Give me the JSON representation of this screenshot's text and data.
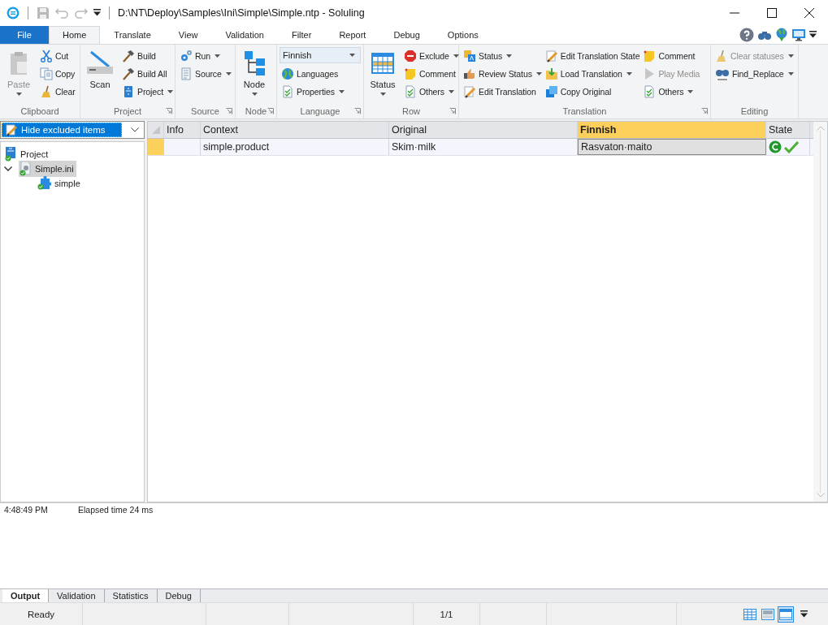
{
  "window": {
    "title": "D:\\NT\\Deploy\\Samples\\Ini\\Simple\\Simple.ntp  -  Soluling"
  },
  "ribbon": {
    "tabs": [
      {
        "label": "File",
        "kind": "file",
        "selected": false
      },
      {
        "label": "Home",
        "kind": "tab",
        "selected": true
      },
      {
        "label": "Translate",
        "kind": "tab",
        "selected": false
      },
      {
        "label": "View",
        "kind": "tab",
        "selected": false
      },
      {
        "label": "Validation",
        "kind": "tab",
        "selected": false
      },
      {
        "label": "Filter",
        "kind": "tab",
        "selected": false
      },
      {
        "label": "Report",
        "kind": "tab",
        "selected": false
      },
      {
        "label": "Debug",
        "kind": "tab",
        "selected": false
      },
      {
        "label": "Options",
        "kind": "tab",
        "selected": false
      }
    ],
    "groups": [
      {
        "label": "Clipboard",
        "launcher": false,
        "columns": [
          [
            {
              "kind": "large",
              "label": "Paste",
              "dropdown": true,
              "disabled": true
            }
          ],
          [
            {
              "kind": "small",
              "label": "Cut",
              "dropdown": false,
              "disabled": false
            },
            {
              "kind": "small",
              "label": "Copy",
              "dropdown": false,
              "disabled": false
            },
            {
              "kind": "small",
              "label": "Clear",
              "dropdown": false,
              "disabled": false
            }
          ]
        ]
      },
      {
        "label": "Project",
        "launcher": true,
        "columns": [
          [
            {
              "kind": "large",
              "label": "Scan",
              "dropdown": false,
              "disabled": false
            }
          ],
          [
            {
              "kind": "small",
              "label": "Build",
              "dropdown": false,
              "disabled": false
            },
            {
              "kind": "small",
              "label": "Build All",
              "dropdown": false,
              "disabled": false
            },
            {
              "kind": "small",
              "label": "Project",
              "dropdown": true,
              "disabled": false
            }
          ]
        ]
      },
      {
        "label": "Source",
        "launcher": true,
        "columns": [
          [
            {
              "kind": "small",
              "label": "Run",
              "dropdown": true,
              "disabled": false
            },
            {
              "kind": "small",
              "label": "Source",
              "dropdown": true,
              "disabled": false
            }
          ]
        ]
      },
      {
        "label": "Node",
        "launcher": true,
        "columns": [
          [
            {
              "kind": "large",
              "label": "Node",
              "dropdown": true,
              "disabled": false
            }
          ]
        ]
      },
      {
        "label": "Language",
        "launcher": true,
        "columns": [
          [
            {
              "kind": "combo",
              "label": "Finnish",
              "dropdown": true,
              "disabled": false
            },
            {
              "kind": "small",
              "label": "Languages",
              "dropdown": false,
              "disabled": false
            },
            {
              "kind": "small",
              "label": "Properties",
              "dropdown": true,
              "disabled": false
            }
          ]
        ]
      },
      {
        "label": "Row",
        "launcher": true,
        "columns": [
          [
            {
              "kind": "large",
              "label": "Status",
              "dropdown": true,
              "disabled": false
            }
          ],
          [
            {
              "kind": "small",
              "label": "Exclude",
              "dropdown": true,
              "disabled": false
            },
            {
              "kind": "small",
              "label": "Comment",
              "dropdown": false,
              "disabled": false
            },
            {
              "kind": "small",
              "label": "Others",
              "dropdown": true,
              "disabled": false
            }
          ]
        ]
      },
      {
        "label": "Translation",
        "launcher": true,
        "columns": [
          [
            {
              "kind": "small",
              "label": "Status",
              "dropdown": true,
              "disabled": false
            },
            {
              "kind": "small",
              "label": "Review Status",
              "dropdown": true,
              "disabled": false
            },
            {
              "kind": "small",
              "label": "Edit Translation",
              "dropdown": false,
              "disabled": false
            }
          ],
          [
            {
              "kind": "small",
              "label": "Edit Translation State",
              "dropdown": false,
              "disabled": false
            },
            {
              "kind": "small",
              "label": "Load Translation",
              "dropdown": true,
              "disabled": false
            },
            {
              "kind": "small",
              "label": "Copy Original",
              "dropdown": false,
              "disabled": false
            }
          ],
          [
            {
              "kind": "small",
              "label": "Comment",
              "dropdown": false,
              "disabled": false
            },
            {
              "kind": "small",
              "label": "Play Media",
              "dropdown": false,
              "disabled": true
            },
            {
              "kind": "small",
              "label": "Others",
              "dropdown": true,
              "disabled": false
            }
          ]
        ]
      },
      {
        "label": "Editing",
        "launcher": false,
        "columns": [
          [
            {
              "kind": "small",
              "label": "Clear statuses",
              "dropdown": true,
              "disabled": true
            },
            {
              "kind": "small",
              "label": "Find_Replace",
              "dropdown": true,
              "disabled": false
            }
          ]
        ]
      }
    ]
  },
  "filter": {
    "value": "Hide excluded items"
  },
  "tree": [
    {
      "label": "Project",
      "selected": false,
      "children": [
        {
          "label": "Simple.ini",
          "expanded": true,
          "selected": true,
          "children": [
            {
              "label": "simple",
              "selected": false
            }
          ]
        }
      ]
    }
  ],
  "grid": {
    "columns": [
      {
        "label": "Info",
        "highlighted": false
      },
      {
        "label": "Context",
        "highlighted": false
      },
      {
        "label": "Original",
        "highlighted": false
      },
      {
        "label": "Finnish",
        "highlighted": true
      },
      {
        "label": "State",
        "highlighted": false
      }
    ],
    "rows": [
      {
        "selected": true,
        "cells": [
          "",
          "simple.product",
          "Skim·milk",
          "Rasvaton·maito"
        ]
      }
    ]
  },
  "output": {
    "rows": [
      {
        "time": "4:48:49 PM",
        "message": "Elapsed time 24 ms"
      }
    ]
  },
  "bottom_tabs": [
    {
      "label": "Output",
      "selected": true
    },
    {
      "label": "Validation",
      "selected": false
    },
    {
      "label": "Statistics",
      "selected": false
    },
    {
      "label": "Debug",
      "selected": false
    }
  ],
  "status_bar": {
    "panels": [
      "Ready",
      "1/1"
    ],
    "views": [
      {
        "selected": false
      },
      {
        "selected": false
      },
      {
        "selected": true
      }
    ]
  }
}
